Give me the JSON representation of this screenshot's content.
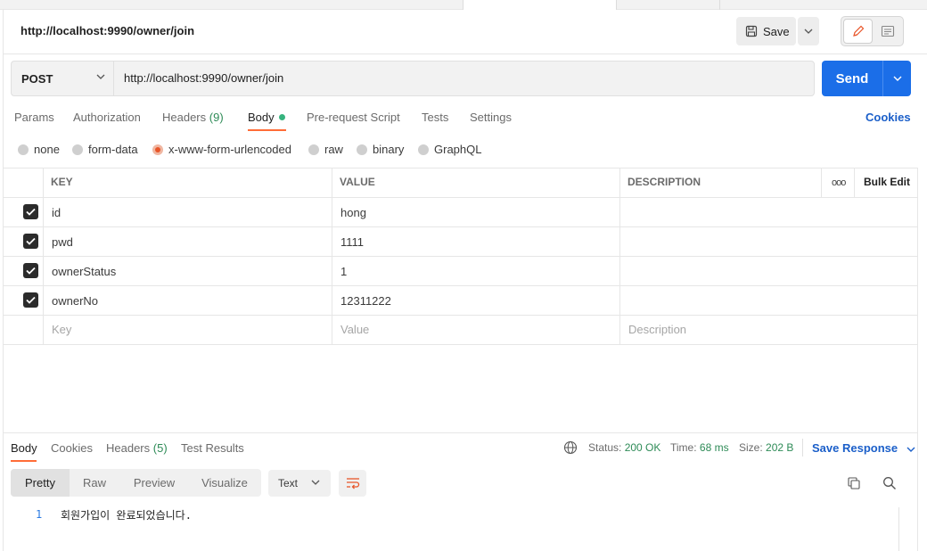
{
  "request": {
    "title": "http://localhost:9990/owner/join",
    "save_label": "Save",
    "method": "POST",
    "url": "http://localhost:9990/owner/join",
    "send_label": "Send"
  },
  "request_tabs": {
    "params": "Params",
    "authorization": "Authorization",
    "headers": "Headers",
    "headers_count": "(9)",
    "body": "Body",
    "prerequest": "Pre-request Script",
    "tests": "Tests",
    "settings": "Settings",
    "cookies": "Cookies"
  },
  "body_types": {
    "none": "none",
    "form_data": "form-data",
    "urlencoded": "x-www-form-urlencoded",
    "raw": "raw",
    "binary": "binary",
    "graphql": "GraphQL",
    "selected": "x-www-form-urlencoded"
  },
  "params_table": {
    "headers": {
      "key": "KEY",
      "value": "VALUE",
      "description": "DESCRIPTION",
      "more": "ooo",
      "bulk_edit": "Bulk Edit"
    },
    "rows": [
      {
        "key": "id",
        "value": "hong",
        "description": "",
        "checked": true
      },
      {
        "key": "pwd",
        "value": "1111",
        "description": "",
        "checked": true
      },
      {
        "key": "ownerStatus",
        "value": "1",
        "description": "",
        "checked": true
      },
      {
        "key": "ownerNo",
        "value": "12311222",
        "description": "",
        "checked": true
      }
    ],
    "placeholders": {
      "key": "Key",
      "value": "Value",
      "description": "Description"
    }
  },
  "response": {
    "tabs": {
      "body": "Body",
      "cookies": "Cookies",
      "headers": "Headers",
      "headers_count": "(5)",
      "test_results": "Test Results"
    },
    "status_label": "Status:",
    "status_value": "200 OK",
    "time_label": "Time:",
    "time_value": "68 ms",
    "size_label": "Size:",
    "size_value": "202 B",
    "save_response": "Save Response",
    "views": {
      "pretty": "Pretty",
      "raw": "Raw",
      "preview": "Preview",
      "visualize": "Visualize"
    },
    "format": "Text",
    "lines": [
      {
        "number": "1",
        "text": "회원가입이 완료되었습니다."
      }
    ]
  },
  "colors": {
    "accent_orange": "#ff6c37",
    "send_blue": "#1b6ee8",
    "link_blue": "#1b5fc9",
    "status_green": "#2e8b57"
  },
  "icons": [
    "save-icon",
    "chevron-down-icon",
    "pencil-icon",
    "document-icon",
    "globe-icon",
    "wrap-lines-icon",
    "copy-icon",
    "search-icon",
    "checkmark-icon",
    "more-options-icon"
  ]
}
